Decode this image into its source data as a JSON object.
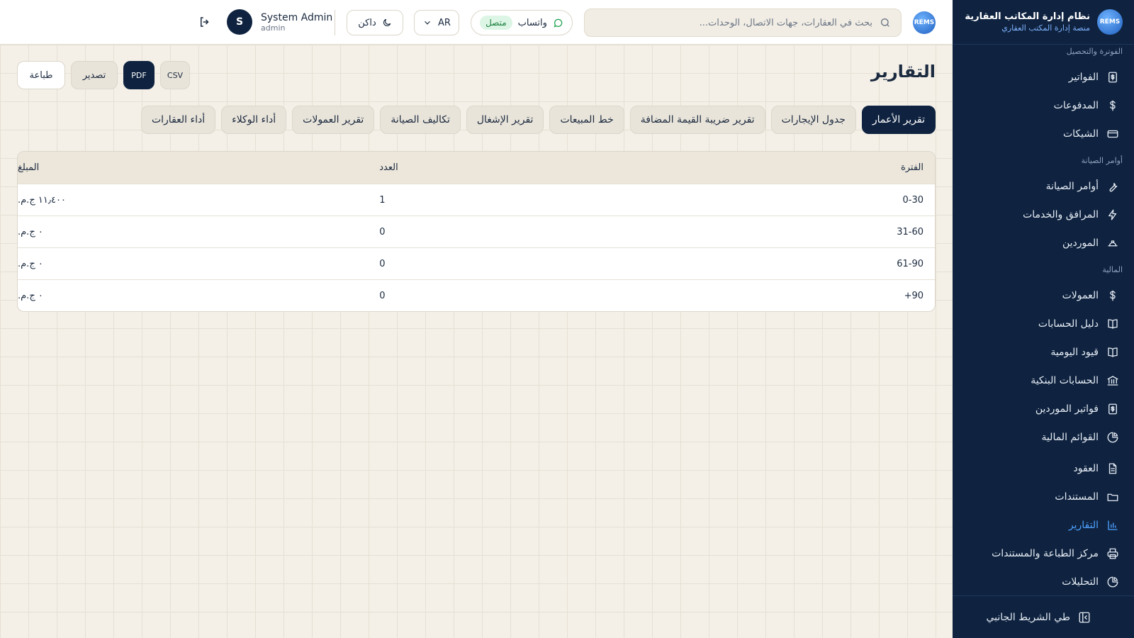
{
  "brand": {
    "logo_text": "REMS",
    "title": "نظام إدارة المكاتب العقارية",
    "subtitle": "منصة إدارة المكتب العقاري"
  },
  "sidebar": {
    "sections": [
      {
        "label": "الفوترة والتحصيل",
        "items": [
          {
            "label": "الفواتير",
            "icon": "invoice-icon"
          },
          {
            "label": "المدفوعات",
            "icon": "dollar-icon"
          },
          {
            "label": "الشيكات",
            "icon": "card-icon"
          }
        ]
      },
      {
        "label": "أوامر الصيانة",
        "items": [
          {
            "label": "أوامر الصيانة",
            "icon": "wrench-icon"
          },
          {
            "label": "المرافق والخدمات",
            "icon": "bolt-icon"
          },
          {
            "label": "الموردين",
            "icon": "hardhat-icon"
          }
        ]
      },
      {
        "label": "المالية",
        "items": [
          {
            "label": "العمولات",
            "icon": "dollar-icon"
          },
          {
            "label": "دليل الحسابات",
            "icon": "book-icon"
          },
          {
            "label": "قيود اليومية",
            "icon": "book-icon"
          },
          {
            "label": "الحسابات البنكية",
            "icon": "bank-icon"
          },
          {
            "label": "فواتير الموردين",
            "icon": "invoice-icon"
          },
          {
            "label": "القوائم المالية",
            "icon": "pie-icon"
          }
        ]
      },
      {
        "label": "",
        "items": [
          {
            "label": "العقود",
            "icon": "file-icon"
          },
          {
            "label": "المستندات",
            "icon": "folder-icon"
          },
          {
            "label": "التقارير",
            "icon": "chart-icon",
            "active": true
          },
          {
            "label": "مركز الطباعة والمستندات",
            "icon": "printer-icon"
          },
          {
            "label": "التحليلات",
            "icon": "pie-icon"
          }
        ]
      }
    ],
    "collapse_label": "طي الشريط الجانبي"
  },
  "header": {
    "search_placeholder": "بحث في العقارات، جهات الاتصال، الوحدات...",
    "whatsapp_label": "واتساب",
    "whatsapp_status": "متصل",
    "lang_label": "AR",
    "theme_label": "داكن",
    "user_name": "System Admin",
    "user_role": "admin",
    "user_initial": "S"
  },
  "page": {
    "title": "التقارير",
    "actions": {
      "print": "طباعة",
      "export": "تصدير",
      "pdf": "PDF",
      "csv": "CSV"
    },
    "tabs": [
      {
        "label": "تقرير الأعمار",
        "active": true
      },
      {
        "label": "جدول الإيجارات"
      },
      {
        "label": "تقرير ضريبة القيمة المضافة"
      },
      {
        "label": "خط المبيعات"
      },
      {
        "label": "تقرير الإشغال"
      },
      {
        "label": "تكاليف الصيانة"
      },
      {
        "label": "تقرير العمولات"
      },
      {
        "label": "أداء الوكلاء"
      },
      {
        "label": "أداء العقارات"
      }
    ],
    "table": {
      "headers": [
        "الفترة",
        "العدد",
        "المبلغ"
      ],
      "rows": [
        [
          "0-30",
          "1",
          "١١٫٤٠٠ ج.م."
        ],
        [
          "31-60",
          "0",
          "٠ ج.م."
        ],
        [
          "61-90",
          "0",
          "٠ ج.م."
        ],
        [
          "+90",
          "0",
          "٠ ج.م."
        ]
      ]
    }
  },
  "colors": {
    "sidebar_bg": "#0f2340",
    "accent": "#4ea1ff",
    "page_bg": "#f4f0e8",
    "whatsapp_green": "#1aa14a"
  }
}
